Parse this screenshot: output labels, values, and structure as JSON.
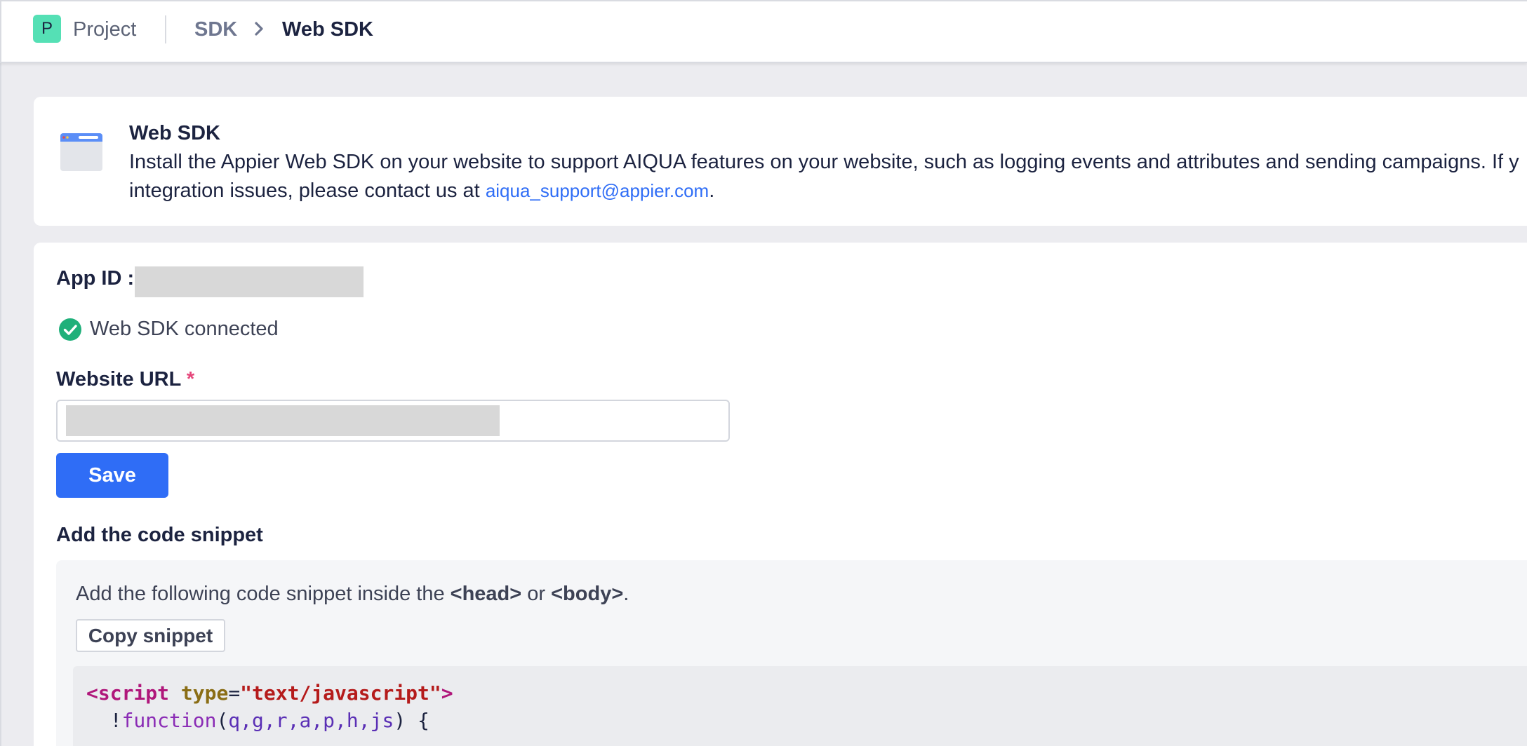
{
  "topbar": {
    "project_badge": "P",
    "project_name": "Project",
    "breadcrumb_parent": "SDK",
    "breadcrumb_current": "Web SDK"
  },
  "info": {
    "icon": "browser-window-icon",
    "title": "Web SDK",
    "text_line1": "Install the Appier Web SDK on your website to support AIQUA features on your website, such as logging events and attributes and sending campaigns. If y",
    "text_line2_prefix": "integration issues, please contact us at ",
    "support_email": "aiqua_support@appier.com",
    "text_line2_suffix": "."
  },
  "form": {
    "app_id_label": "App ID :",
    "status_icon": "check-circle-icon",
    "status_text": "Web SDK connected",
    "url_label": "Website URL",
    "url_required_mark": "*",
    "save_label": "Save"
  },
  "snippet": {
    "title": "Add the code snippet",
    "desc_prefix": "Add the following code snippet inside the ",
    "desc_head": "<head>",
    "desc_or": " or ",
    "desc_body": "<body>",
    "desc_suffix": ".",
    "copy_label": "Copy snippet",
    "code": {
      "l1_tag_open": "<script",
      "l1_attr": "type",
      "l1_eq": "=",
      "l1_str": "\"text/javascript\"",
      "l1_tag_close": ">",
      "l2_indent": "  !",
      "l2_kw": "function",
      "l2_open": "(",
      "l2_params": "q,g,r,a,p,h,js",
      "l2_close": ") {"
    }
  },
  "colors": {
    "accent": "#2f6df6",
    "success": "#1fb07a",
    "badge": "#55e0b5",
    "required": "#e5457a"
  }
}
